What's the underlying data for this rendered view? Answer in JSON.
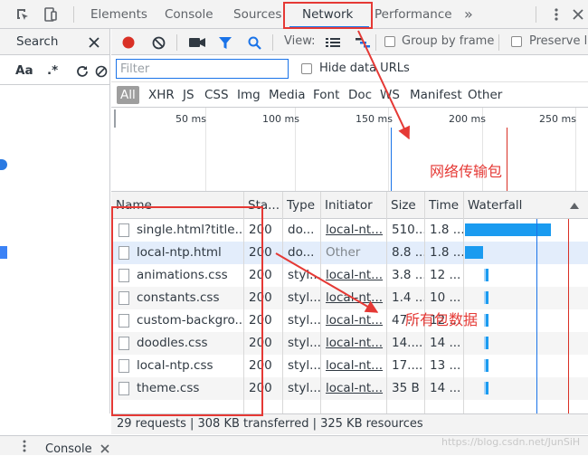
{
  "tabs": {
    "elements": "Elements",
    "console": "Console",
    "sources": "Sources",
    "network": "Network",
    "performance": "Performance",
    "more": "»"
  },
  "search": {
    "title": "Search",
    "case_label": "Aa",
    "regex_label": ".*"
  },
  "toolbar": {
    "view_label": "View:",
    "group_by_frame": "Group by frame",
    "preserve_log": "Preserve lo"
  },
  "filter": {
    "placeholder": "Filter",
    "hide_data_urls": "Hide data URLs"
  },
  "types": [
    "All",
    "XHR",
    "JS",
    "CSS",
    "Img",
    "Media",
    "Font",
    "Doc",
    "WS",
    "Manifest",
    "Other"
  ],
  "overview": {
    "ticks": [
      "50 ms",
      "100 ms",
      "150 ms",
      "200 ms",
      "250 ms"
    ]
  },
  "table": {
    "columns": {
      "name": "Name",
      "status": "Sta...",
      "type": "Type",
      "initiator": "Initiator",
      "size": "Size",
      "time": "Time",
      "waterfall": "Waterfall"
    },
    "rows": [
      {
        "name": "single.html?title...",
        "status": "200",
        "type": "do...",
        "initiator": "local-nt...",
        "size": "510...",
        "time": "1.8 ..."
      },
      {
        "name": "local-ntp.html",
        "status": "200",
        "type": "do...",
        "initiator": "Other",
        "size": "8.8 ...",
        "time": "1.8 ..."
      },
      {
        "name": "animations.css",
        "status": "200",
        "type": "styl...",
        "initiator": "local-nt...",
        "size": "3.8 ...",
        "time": "12 ..."
      },
      {
        "name": "constants.css",
        "status": "200",
        "type": "styl...",
        "initiator": "local-nt...",
        "size": "1.4 ...",
        "time": "10 ..."
      },
      {
        "name": "custom-backgro...",
        "status": "200",
        "type": "styl...",
        "initiator": "local-nt...",
        "size": "47...",
        "time": "12 ..."
      },
      {
        "name": "doodles.css",
        "status": "200",
        "type": "styl...",
        "initiator": "local-nt...",
        "size": "14....",
        "time": "14 ..."
      },
      {
        "name": "local-ntp.css",
        "status": "200",
        "type": "styl...",
        "initiator": "local-nt...",
        "size": "17....",
        "time": "13 ..."
      },
      {
        "name": "theme.css",
        "status": "200",
        "type": "styl...",
        "initiator": "local-nt...",
        "size": "35 B",
        "time": "14 ..."
      }
    ]
  },
  "status": {
    "summary": "29 requests | 308 KB transferred | 325 KB resources"
  },
  "drawer": {
    "console": "Console"
  },
  "annotations": {
    "network_packets": "网络传输包",
    "all_packets": "所有包数据"
  },
  "watermark": "https://blog.csdn.net/JunSiH",
  "colors": {
    "accent": "#1a73e8",
    "record": "#d93025",
    "annotation": "#e53935",
    "waterfall_bar": "#1a9bf0"
  }
}
